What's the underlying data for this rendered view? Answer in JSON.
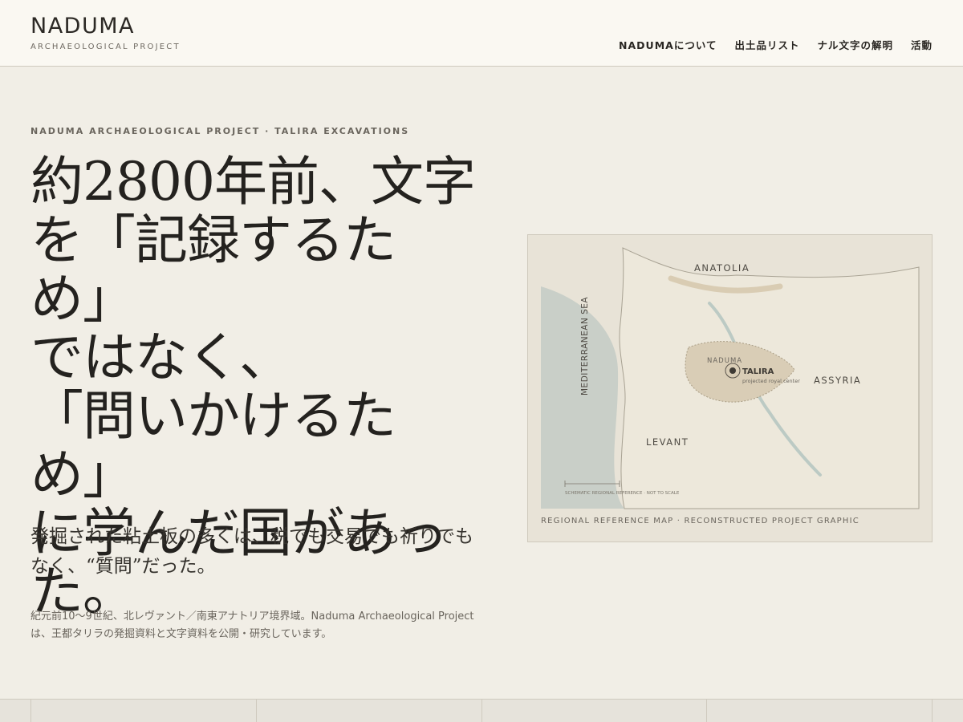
{
  "header": {
    "logo": "NADUMA",
    "logo_sub": "ARCHAEOLOGICAL PROJECT",
    "nav": [
      {
        "label": "NADUMAについて"
      },
      {
        "label": "出土品リスト"
      },
      {
        "label": "ナル文字の解明"
      },
      {
        "label": "活動"
      }
    ]
  },
  "hero": {
    "eyebrow": "NADUMA ARCHAEOLOGICAL PROJECT · TALIRA EXCAVATIONS",
    "headline": "約2800年前、文字\nを「記録するため」\nではなく、\n「問いかけるため」\nに学んだ国があっ\nた。",
    "subhead": "発掘された粘土板の多くは、税でも交易でも祈りでもなく、“質問”だった。",
    "intro": "紀元前10〜9世紀、北レヴァント／南東アナトリア境界域。Naduma Archaeological Projectは、王都タリラの発掘資料と文字資料を公開・研究しています。"
  },
  "map": {
    "labels": {
      "anatolia": "ANATOLIA",
      "sea": "MEDITERRANEAN SEA",
      "assyria": "ASSYRIA",
      "levant": "LEVANT",
      "naduma": "NADUMA",
      "talira": "TALIRA",
      "talira_note": "projected royal center",
      "scale_note": "SCHEMATIC REGIONAL REFERENCE · NOT TO SCALE"
    },
    "caption": "REGIONAL REFERENCE MAP · RECONSTRUCTED PROJECT GRAPHIC",
    "colors": {
      "sea": "#c9cfc8",
      "land": "#ede8db",
      "naduma_region": "#d9cdb6",
      "river": "#bccac4"
    }
  }
}
